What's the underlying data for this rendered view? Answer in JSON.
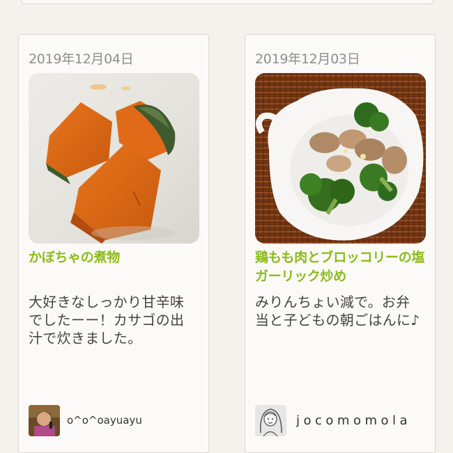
{
  "recipes": [
    {
      "date": "2019年12月04日",
      "photo_icon": "simmered-pumpkin-photo",
      "title": "かぼちゃの煮物",
      "description": "大好きなしっかり甘辛味でしたーー！カサゴの出汁で炊きました。",
      "author": "o^o^oayuayu",
      "avatar_icon": "user-avatar-photo"
    },
    {
      "date": "2019年12月03日",
      "photo_icon": "chicken-broccoli-photo",
      "title": "鶏もも肉とブロッコリーの塩ガーリック炒め",
      "description": "みりんちょい減で。お弁当と子どもの朝ごはんに♪",
      "author": "jocomomola",
      "avatar_icon": "sketch-avatar"
    }
  ]
}
